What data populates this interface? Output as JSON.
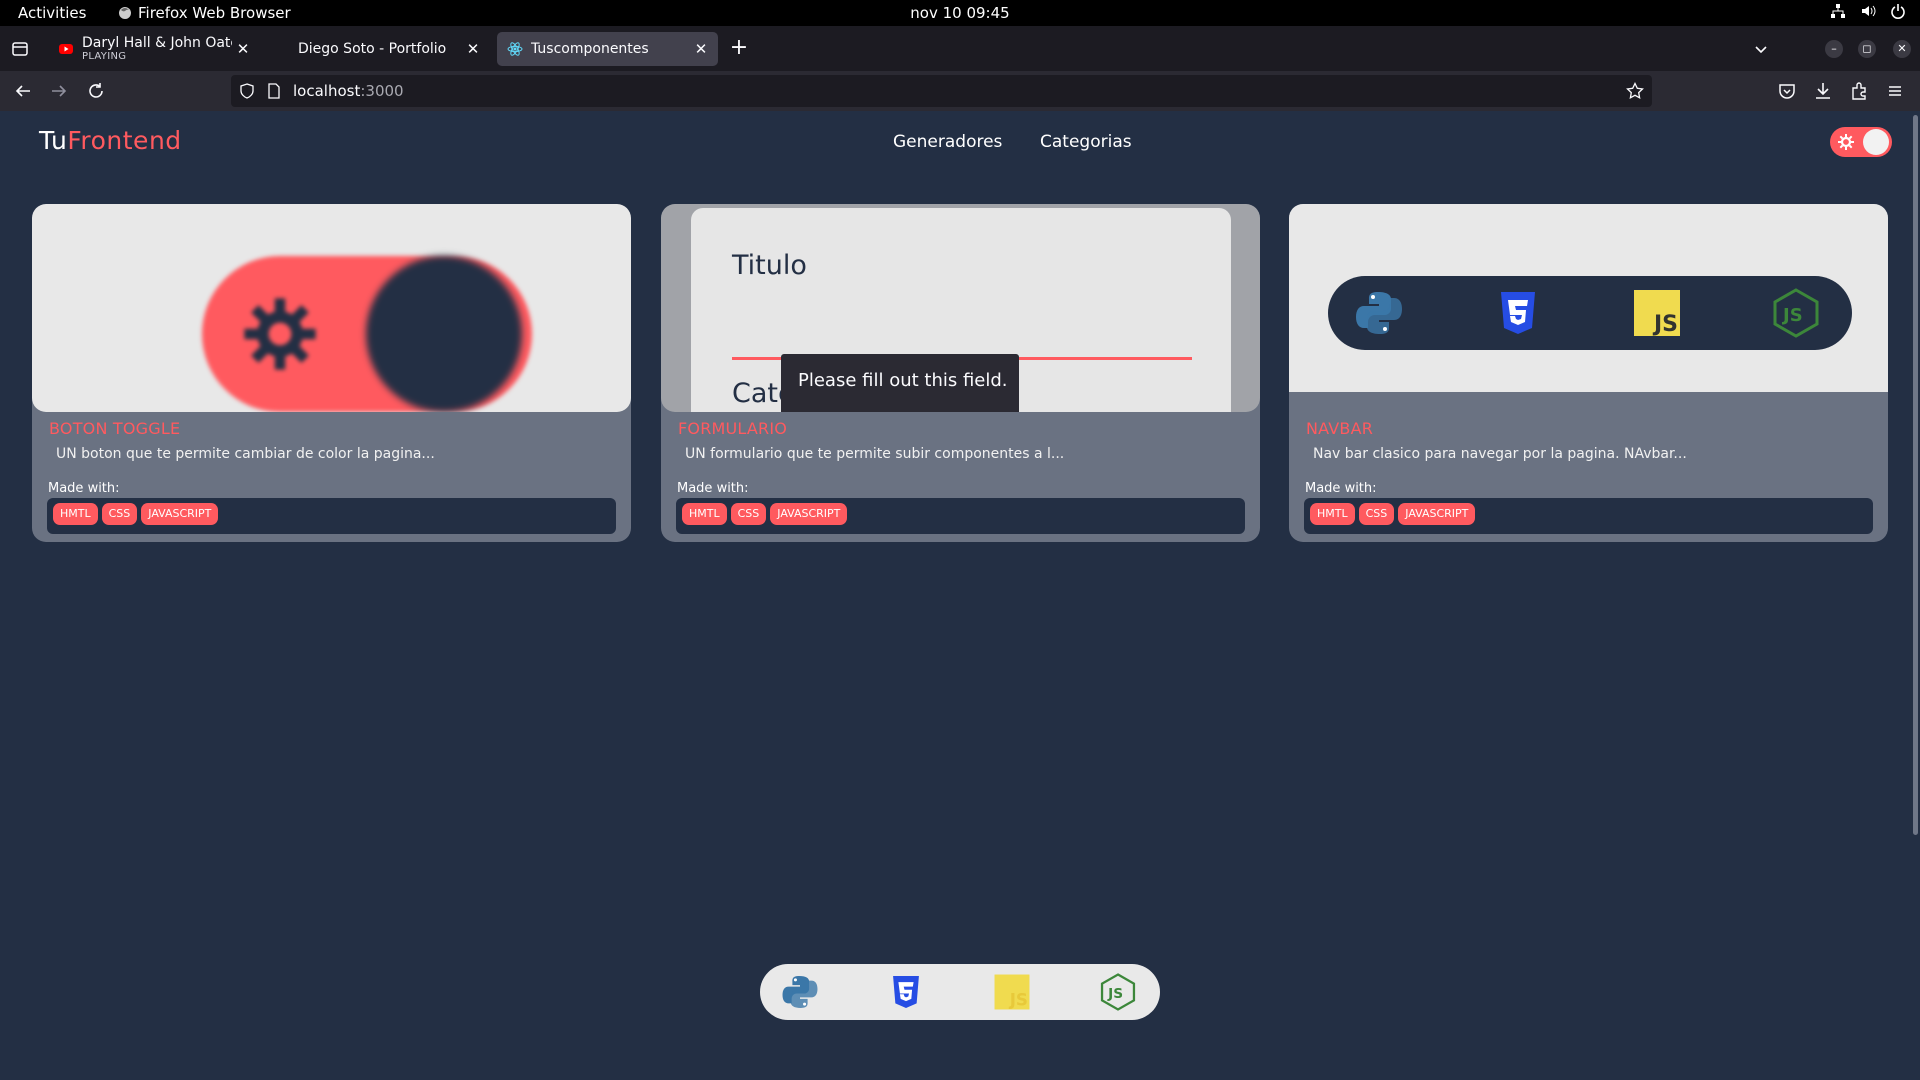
{
  "system_bar": {
    "activities": "Activities",
    "app_name": "Firefox Web Browser",
    "clock": "nov 10  09:45"
  },
  "tabs": [
    {
      "title": "Daryl Hall & John Oates -",
      "subtitle": "PLAYING",
      "favicon": "youtube-icon",
      "active": false
    },
    {
      "title": "Diego Soto - Portfolio",
      "favicon": "",
      "active": false
    },
    {
      "title": "Tuscomponentes",
      "favicon": "react-icon",
      "active": true
    }
  ],
  "urlbar": {
    "host": "localhost",
    "port": ":3000"
  },
  "site": {
    "logo_prefix": "Tu",
    "logo_accent": "Frontend",
    "nav": [
      "Generadores",
      "Categorias"
    ],
    "made_with_label": "Made with:"
  },
  "cards": [
    {
      "title": "BOTON TOGGLE",
      "description": "UN boton que te permite cambiar de color la pagina...",
      "tags": [
        "HMTL",
        "CSS",
        "JAVASCRIPT"
      ]
    },
    {
      "title": "FORMULARIO",
      "description": "UN formulario que te permite subir componentes a l...",
      "tags": [
        "HMTL",
        "CSS",
        "JAVASCRIPT"
      ],
      "preview": {
        "field_label_1": "Titulo",
        "field_label_2": "Categorias",
        "validation_tooltip": "Please fill out this field."
      }
    },
    {
      "title": "NAVBAR",
      "description": "Nav bar clasico para navegar por la pagina. NAvbar...",
      "tags": [
        "HMTL",
        "CSS",
        "JAVASCRIPT"
      ],
      "preview_icons": [
        "python-icon",
        "css3-icon",
        "javascript-icon",
        "nodejs-icon"
      ]
    }
  ],
  "dock_icons": [
    "python-icon",
    "css3-icon",
    "javascript-icon",
    "nodejs-icon"
  ],
  "colors": {
    "accent": "#ff5a5f",
    "page_bg": "#232f44",
    "card_bg": "#6a7282"
  }
}
